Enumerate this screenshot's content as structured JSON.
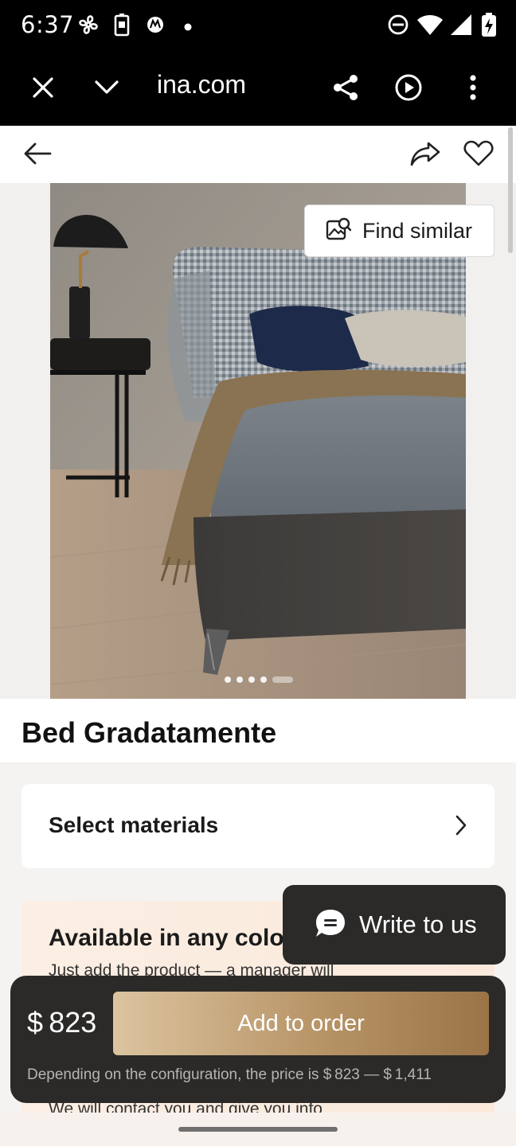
{
  "status_bar": {
    "time": "6:37",
    "left_icons": [
      "fan-icon",
      "battery-saver-icon",
      "motorola-icon",
      "dot-icon"
    ],
    "right_icons": [
      "dnd-icon",
      "wifi-icon",
      "signal-icon",
      "battery-charging-icon"
    ]
  },
  "browser": {
    "url": "ina.com",
    "icons": [
      "close-icon",
      "chevron-down-icon",
      "share-icon",
      "play-icon",
      "more-vert-icon"
    ]
  },
  "header": {
    "icons": [
      "back-arrow-icon",
      "share-arrow-icon",
      "heart-icon"
    ]
  },
  "gallery": {
    "find_similar_label": "Find similar",
    "slides_total": 5,
    "active_slide": 5
  },
  "product": {
    "title": "Bed Gradatamente"
  },
  "select_materials": {
    "label": "Select materials"
  },
  "color_banner": {
    "title": "Available in any color",
    "subtitle": "Just add the product — a manager will",
    "subtitle2": "We will contact you and give you info"
  },
  "chat": {
    "label": "Write to us"
  },
  "order": {
    "price": "$ 823",
    "button_label": "Add to order",
    "price_range": "Depending on the configuration, the price is $ 823 — $ 1,411"
  },
  "colors": {
    "accent_gold_start": "#dcc4a0",
    "accent_gold_end": "#9a7446",
    "dark_panel": "#2b2a29"
  }
}
